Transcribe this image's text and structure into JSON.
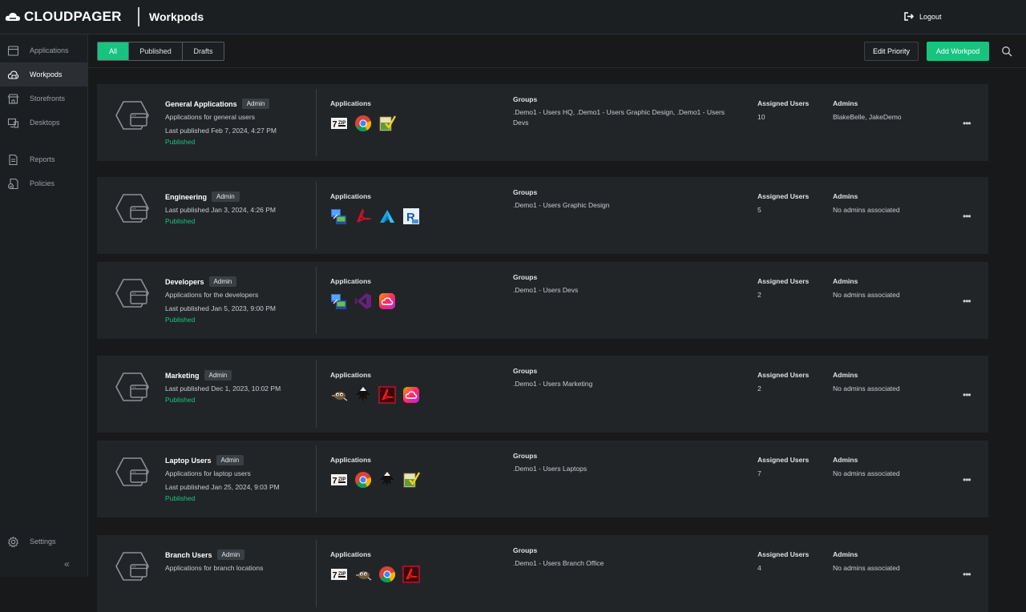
{
  "header": {
    "brand": "CLOUDPAGER",
    "title": "Workpods",
    "logout_label": "Logout"
  },
  "sidebar": {
    "items": [
      {
        "label": "Applications",
        "icon": "window-icon"
      },
      {
        "label": "Workpods",
        "icon": "cloud-icon"
      },
      {
        "label": "Storefronts",
        "icon": "store-icon"
      },
      {
        "label": "Desktops",
        "icon": "desktops-icon"
      },
      {
        "label": "Reports",
        "icon": "report-icon"
      },
      {
        "label": "Policies",
        "icon": "policy-icon"
      }
    ],
    "settings_label": "Settings",
    "collapse_label": "«"
  },
  "toolbar": {
    "filters": [
      "All",
      "Published",
      "Drafts"
    ],
    "active_filter": "All",
    "edit_priority_label": "Edit Priority",
    "add_workpod_label": "Add Workpod"
  },
  "labels": {
    "applications": "Applications",
    "groups": "Groups",
    "assigned_users": "Assigned Users",
    "admins": "Admins",
    "last_published": "Last published",
    "kebab": "•••"
  },
  "workpods": [
    {
      "name": "General Applications",
      "badge": "Admin",
      "description": "Applications for general users",
      "last_published": "Feb 7, 2024, 4:27 PM",
      "status": "Published",
      "apps": [
        "7zip-icon",
        "chrome-icon",
        "notepad-check-icon"
      ],
      "groups": ".Demo1 - Users HQ, .Demo1 - Users Graphic Design, .Demo1 - Users Devs",
      "assigned_users": "10",
      "admins": "BlakeBelle, JakeDemo"
    },
    {
      "name": "Engineering",
      "badge": "Admin",
      "description": "",
      "last_published": "Jan 3, 2024, 4:26 PM",
      "status": "Published",
      "apps": [
        "remote-desktop-icon",
        "acrobat-red-icon",
        "autodesk-icon",
        "revit-icon"
      ],
      "groups": ".Demo1 - Users Graphic Design",
      "assigned_users": "5",
      "admins": "No admins associated"
    },
    {
      "name": "Developers",
      "badge": "Admin",
      "description": "Applications for the developers",
      "last_published": "Jan 5, 2023, 9:00 PM",
      "status": "Published",
      "apps": [
        "remote-desktop-icon",
        "visual-studio-icon",
        "creative-cloud-icon"
      ],
      "groups": ".Demo1 - Users Devs",
      "assigned_users": "2",
      "admins": "No admins associated"
    },
    {
      "name": "Marketing",
      "badge": "Admin",
      "description": "",
      "last_published": "Dec 1, 2023, 10:02 PM",
      "status": "Published",
      "apps": [
        "gimp-icon",
        "inkscape-icon",
        "acrobat-icon",
        "creative-cloud-icon"
      ],
      "groups": ".Demo1 - Users Marketing",
      "assigned_users": "2",
      "admins": "No admins associated"
    },
    {
      "name": "Laptop Users",
      "badge": "Admin",
      "description": "Applications for laptop users",
      "last_published": "Jan 25, 2024, 9:03 PM",
      "status": "Published",
      "apps": [
        "7zip-icon",
        "chrome-icon",
        "inkscape-icon",
        "notepad-check-icon"
      ],
      "groups": ".Demo1 - Users Laptops",
      "assigned_users": "7",
      "admins": "No admins associated"
    },
    {
      "name": "Branch Users",
      "badge": "Admin",
      "description": "Applications for branch locations",
      "last_published": "",
      "status": "",
      "apps": [
        "7zip-icon",
        "gimp-icon",
        "chrome-icon",
        "acrobat-icon"
      ],
      "groups": ".Demo1 - Users Branch Office",
      "assigned_users": "4",
      "admins": "No admins associated"
    }
  ],
  "colors": {
    "accent": "#17c37f",
    "background": "#17191b",
    "card": "#222528"
  }
}
